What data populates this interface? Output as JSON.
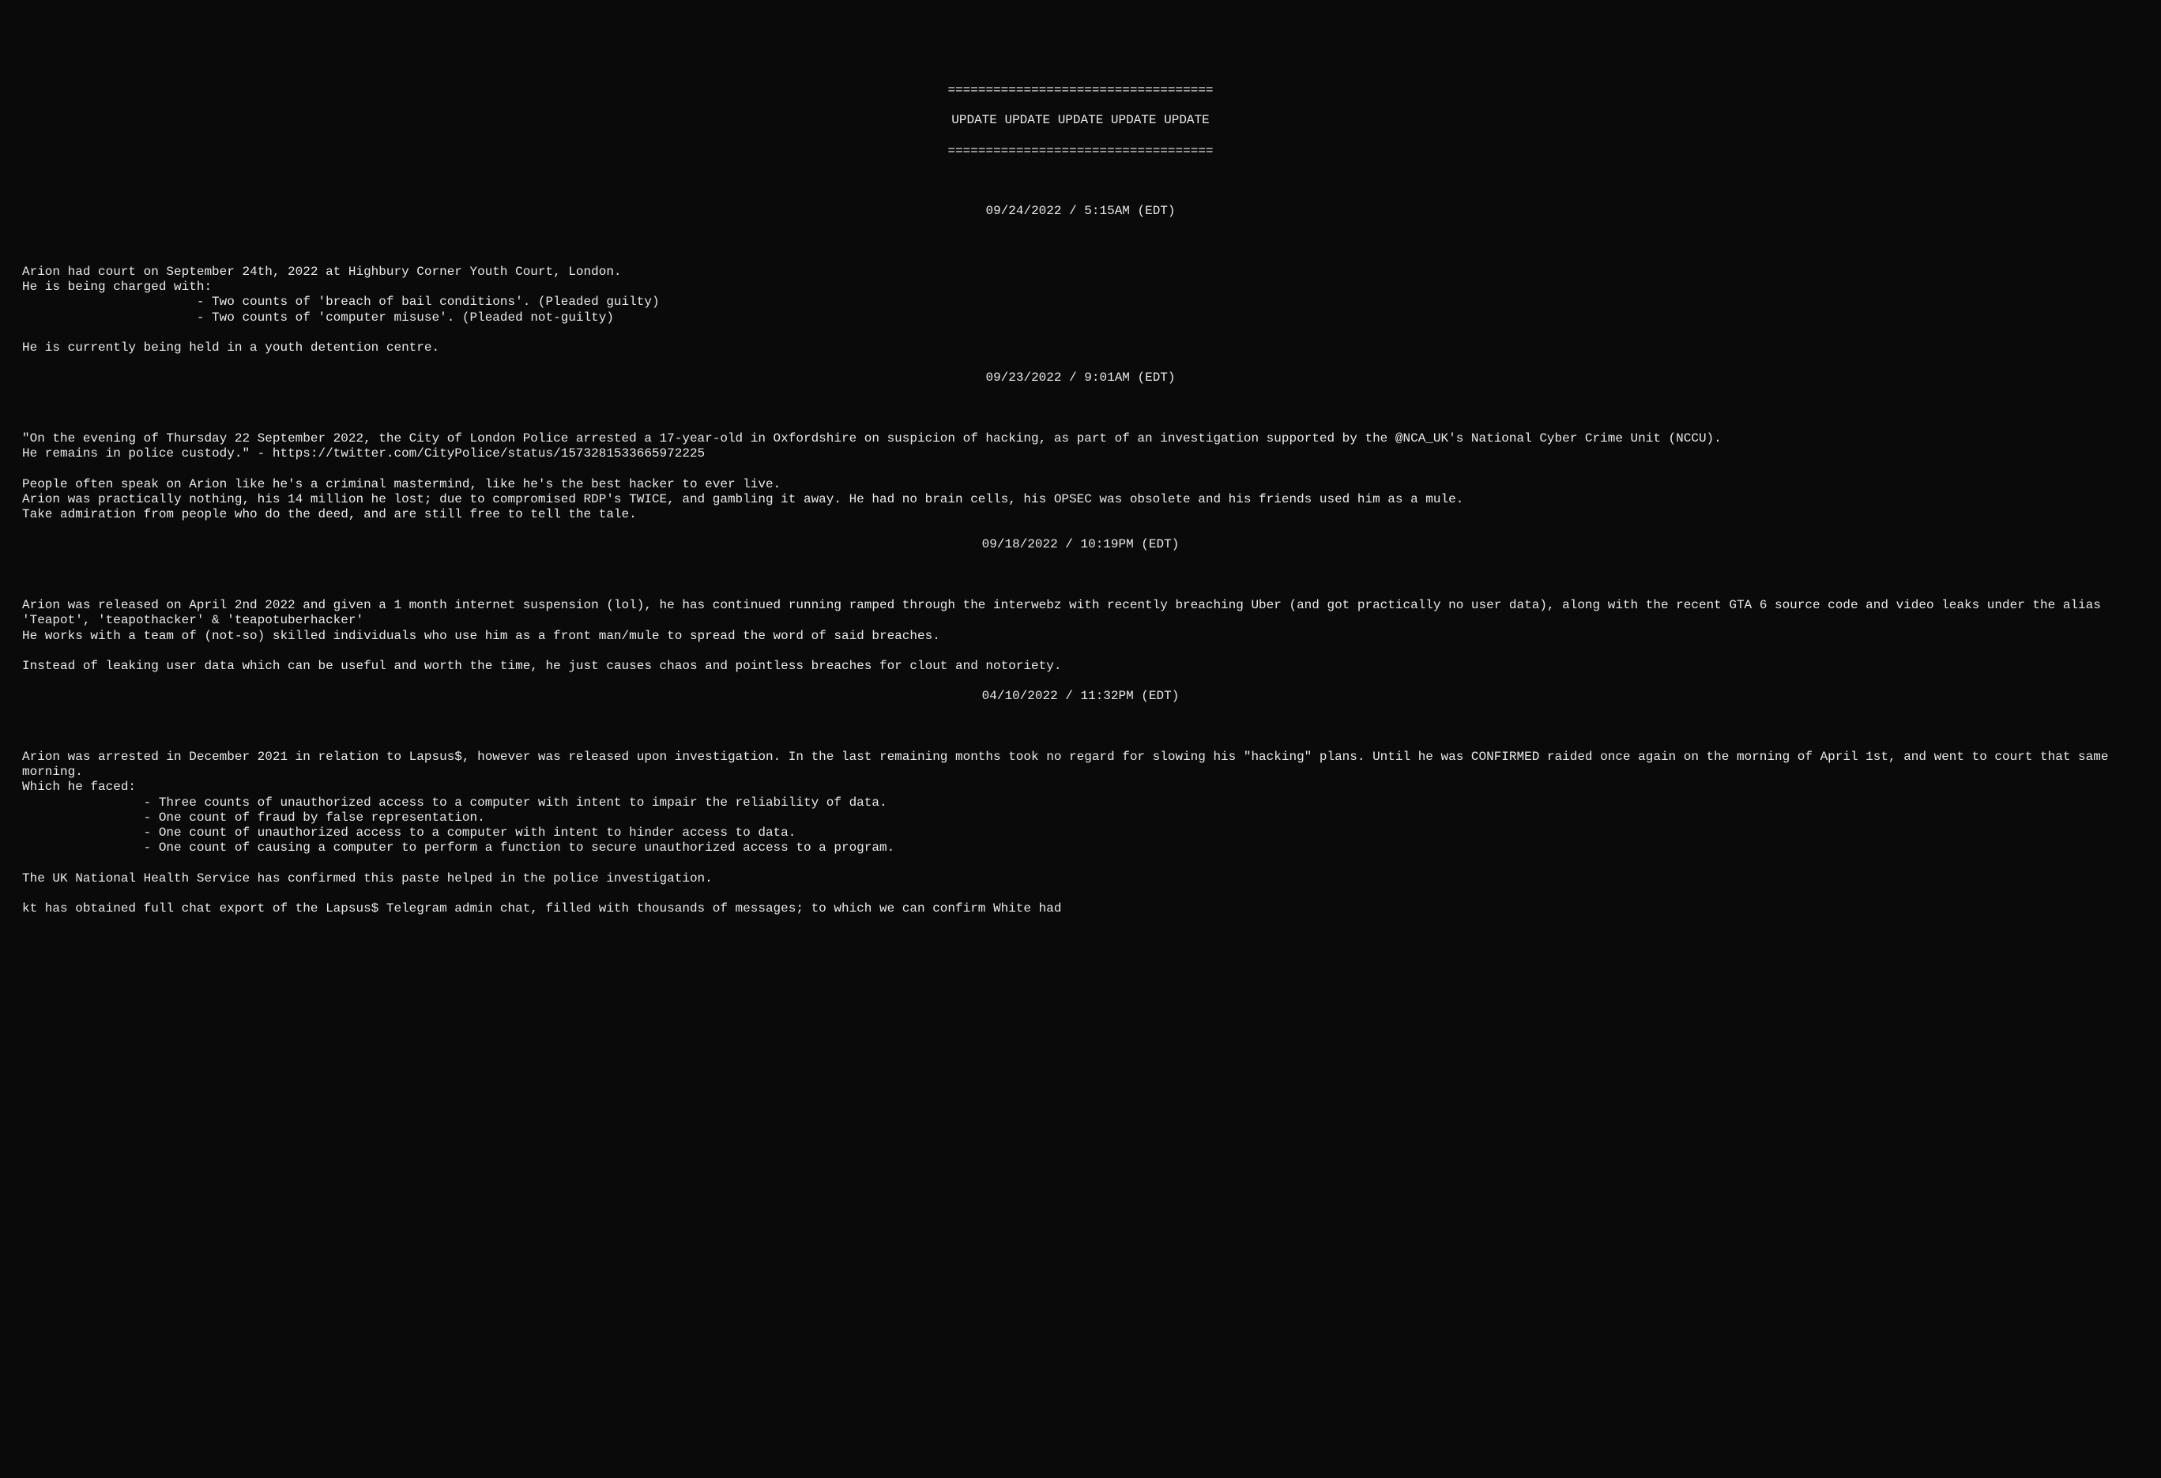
{
  "header": {
    "sep": "===================================",
    "title": "UPDATE UPDATE UPDATE UPDATE UPDATE"
  },
  "updates": [
    {
      "date": "09/24/2022 / 5:15AM (EDT)",
      "body": "Arion had court on September 24th, 2022 at Highbury Corner Youth Court, London.\nHe is being charged with:\n                       - Two counts of 'breach of bail conditions'. (Pleaded guilty)\n                       - Two counts of 'computer misuse'. (Pleaded not-guilty)\n\nHe is currently being held in a youth detention centre."
    },
    {
      "date": "09/23/2022 / 9:01AM (EDT)",
      "body": "\"On the evening of Thursday 22 September 2022, the City of London Police arrested a 17-year-old in Oxfordshire on suspicion of hacking, as part of an investigation supported by the @NCA_UK's National Cyber Crime Unit (NCCU).\nHe remains in police custody.\" - https://twitter.com/CityPolice/status/1573281533665972225\n\nPeople often speak on Arion like he's a criminal mastermind, like he's the best hacker to ever live.\nArion was practically nothing, his 14 million he lost; due to compromised RDP's TWICE, and gambling it away. He had no brain cells, his OPSEC was obsolete and his friends used him as a mule.\nTake admiration from people who do the deed, and are still free to tell the tale.\n"
    },
    {
      "date": "09/18/2022 / 10:19PM (EDT)",
      "body": "Arion was released on April 2nd 2022 and given a 1 month internet suspension (lol), he has continued running ramped through the interwebz with recently breaching Uber (and got practically no user data), along with the recent GTA 6 source code and video leaks under the alias 'Teapot', 'teapothacker' & 'teapotuberhacker'\nHe works with a team of (not-so) skilled individuals who use him as a front man/mule to spread the word of said breaches.\n\nInstead of leaking user data which can be useful and worth the time, he just causes chaos and pointless breaches for clout and notoriety.\n"
    },
    {
      "date": "04/10/2022 / 11:32PM (EDT)",
      "body": "Arion was arrested in December 2021 in relation to Lapsus$, however was released upon investigation. In the last remaining months took no regard for slowing his \"hacking\" plans. Until he was CONFIRMED raided once again on the morning of April 1st, and went to court that same morning.\nWhich he faced:\n                - Three counts of unauthorized access to a computer with intent to impair the reliability of data.\n                - One count of fraud by false representation.\n                - One count of unauthorized access to a computer with intent to hinder access to data.\n                - One count of causing a computer to perform a function to secure unauthorized access to a program.\n\nThe UK National Health Service has confirmed this paste helped in the police investigation.\n\nkt has obtained full chat export of the Lapsus$ Telegram admin chat, filled with thousands of messages; to which we can confirm White had"
    }
  ]
}
